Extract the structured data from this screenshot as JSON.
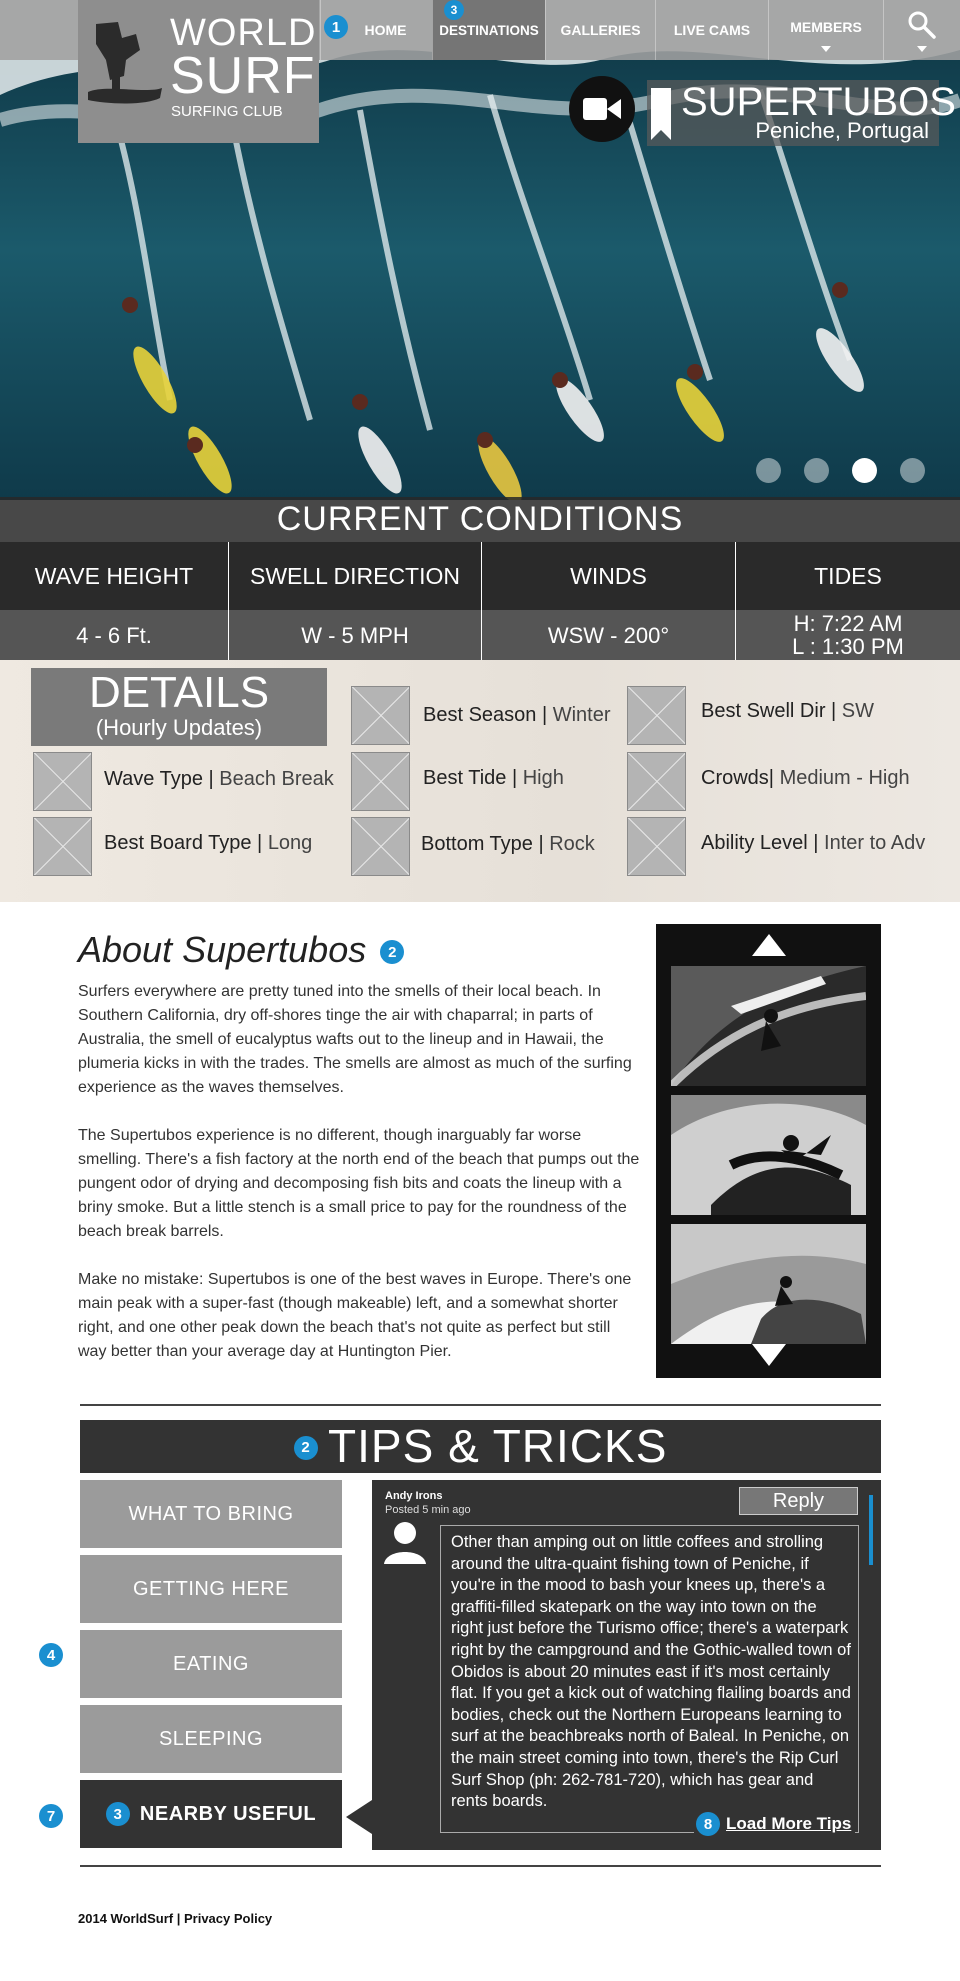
{
  "brand": {
    "logo_line1": "WORLD",
    "logo_line2": "SURF",
    "logo_line3": "SURFING CLUB"
  },
  "nav": {
    "items": [
      {
        "label": "HOME",
        "badge": "1",
        "active": false
      },
      {
        "label": "DESTINATIONS",
        "badge": "3",
        "active": true
      },
      {
        "label": "GALLERIES",
        "active": false
      },
      {
        "label": "LIVE CAMS",
        "active": false
      },
      {
        "label": "MEMBERS",
        "active": false,
        "dropdown": true
      }
    ],
    "search_icon": "search-icon"
  },
  "hero": {
    "spot_name": "SUPERTUBOS",
    "spot_location": "Peniche, Portugal",
    "camera_icon": "video-camera-icon",
    "bookmark_icon": "bookmark-icon",
    "slides_total": 4,
    "slide_active": 3
  },
  "conditions": {
    "title": "CURRENT CONDITIONS",
    "headers": [
      "WAVE HEIGHT",
      "SWELL DIRECTION",
      "WINDS",
      "TIDES"
    ],
    "values": [
      "4 - 6 Ft.",
      "W - 5 MPH",
      "WSW - 200°",
      "H: 7:22 AM"
    ],
    "tides_low": "L : 1:30 PM"
  },
  "details": {
    "title": "DETAILS",
    "subtitle": "(Hourly Updates)",
    "items": [
      {
        "label": "Best Season",
        "value": "Winter"
      },
      {
        "label": "Best Swell Dir",
        "value": "SW"
      },
      {
        "label": "Wave Type",
        "value": "Beach Break"
      },
      {
        "label": "Best Tide",
        "value": "High"
      },
      {
        "label": "Crowds",
        "value": "Medium - High"
      },
      {
        "label": "Best Board Type",
        "value": "Long"
      },
      {
        "label": "Bottom Type",
        "value": "Rock"
      },
      {
        "label": "Ability Level",
        "value": "Inter to Adv"
      }
    ]
  },
  "about": {
    "title": "About Supertubos",
    "badge": "2",
    "paragraphs": [
      "Surfers everywhere are pretty tuned into the smells of their local beach. In Southern California, dry off-shores tinge the air with chaparral; in parts of Australia, the smell of eucalyptus wafts out to the lineup and in Hawaii, the plumeria kicks in with the trades. The smells are almost as much of the surfing experience as the waves themselves.",
      "The Supertubos experience is no different, though inarguably far worse smelling. There's a fish factory at the north end of the beach that pumps out the pungent odor of drying and decomposing fish bits and coats the lineup with a briny smoke. But a little stench is a small price to pay for the roundness of the beach break barrels.",
      "Make no mistake: Supertubos is one of the best waves in Europe. There's one main peak with a super-fast (though makeable) left, and a somewhat shorter right, and one other peak down the beach that's not quite as perfect but still way better than your average day at Huntington Pier."
    ]
  },
  "tips": {
    "title": "TIPS & TRICKS",
    "badge": "2",
    "tabs": [
      "WHAT TO BRING",
      "GETTING HERE",
      "EATING",
      "SLEEPING",
      "NEARBY USEFUL"
    ],
    "side_badge_eating": "4",
    "side_badge_nearby": "7",
    "nearby_badge": "3",
    "comment": {
      "author": "Andy Irons",
      "posted": "Posted 5 min ago",
      "reply_label": "Reply",
      "text": "Other than amping out on little coffees and strolling around the ultra-quaint fishing town of Peniche, if you're in the mood to bash your knees up, there's a graffiti-filled skatepark on the way into town on the right just before the Turismo office; there's a waterpark right by the campground and the Gothic-walled town of Obidos is about 20 minutes east if it's most certainly flat. If you get a kick out of watching flailing boards and bodies, check out the Northern Europeans learning to surf at the beachbreaks north of Baleal. In Peniche, on the main street coming into town, there's the Rip Curl Surf Shop (ph: 262-781-720), which has gear and rents boards.",
      "load_more_badge": "8",
      "load_more_label": "Load More Tips"
    }
  },
  "footer": {
    "text": "2014 WorldSurf | Privacy Policy"
  }
}
